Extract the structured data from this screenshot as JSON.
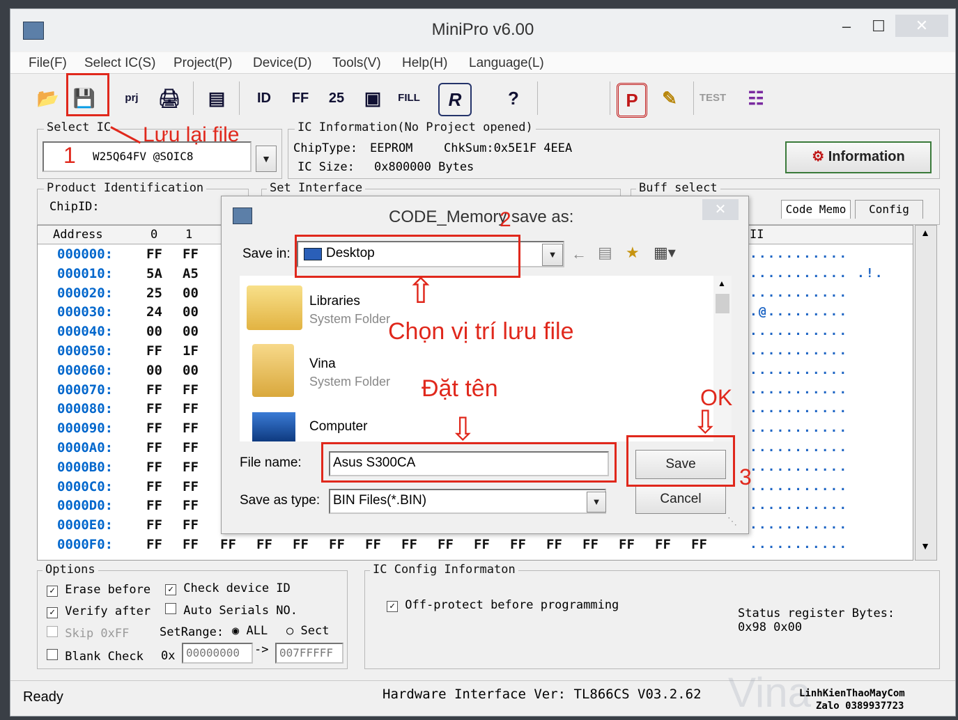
{
  "window": {
    "title": "MiniPro v6.00",
    "minimize": "–",
    "maximize": "☐",
    "close": "✕"
  },
  "menu": [
    "File(F)",
    "Select IC(S)",
    "Project(P)",
    "Device(D)",
    "Tools(V)",
    "Help(H)",
    "Language(L)"
  ],
  "toolbar": {
    "prj_label": "prj",
    "fill_label": "FILL",
    "test_label": "TEST",
    "p_label": "P",
    "r_label": "R",
    "help_label": "?"
  },
  "select_ic": {
    "label": "Select IC",
    "value": "W25Q64FV @SOIC8"
  },
  "ic_info": {
    "label": "IC Information(No Project opened)",
    "chip_type_label": "ChipType:",
    "chip_type": "EEPROM",
    "chksum": "ChkSum:0x5E1F 4EEA",
    "ic_size_label": "IC Size:",
    "ic_size": "0x800000 Bytes",
    "info_button": "Information"
  },
  "product_id": {
    "label": "Product Identification",
    "chip_id_label": "ChipID:"
  },
  "set_interface": {
    "label": "Set Interface"
  },
  "buff_select": {
    "label": "Buff select",
    "tab_code": "Code Memo",
    "tab_config": "Config"
  },
  "grid": {
    "headers": [
      "Address",
      "0",
      "1"
    ],
    "ascii_header": "II",
    "rows": [
      {
        "addr": "000000:",
        "b0": "FF",
        "b1": "FF"
      },
      {
        "addr": "000010:",
        "b0": "5A",
        "b1": "A5"
      },
      {
        "addr": "000020:",
        "b0": "25",
        "b1": "00"
      },
      {
        "addr": "000030:",
        "b0": "24",
        "b1": "00"
      },
      {
        "addr": "000040:",
        "b0": "00",
        "b1": "00"
      },
      {
        "addr": "000050:",
        "b0": "FF",
        "b1": "1F"
      },
      {
        "addr": "000060:",
        "b0": "00",
        "b1": "00"
      },
      {
        "addr": "000070:",
        "b0": "FF",
        "b1": "FF"
      },
      {
        "addr": "000080:",
        "b0": "FF",
        "b1": "FF"
      },
      {
        "addr": "000090:",
        "b0": "FF",
        "b1": "FF"
      },
      {
        "addr": "0000A0:",
        "b0": "FF",
        "b1": "FF"
      },
      {
        "addr": "0000B0:",
        "b0": "FF",
        "b1": "FF"
      },
      {
        "addr": "0000C0:",
        "b0": "FF",
        "b1": "FF"
      },
      {
        "addr": "0000D0:",
        "b0": "FF",
        "b1": "FF"
      },
      {
        "addr": "0000E0:",
        "b0": "FF",
        "b1": "FF"
      },
      {
        "addr": "0000F0:",
        "b0": "FF",
        "b1": "FF"
      }
    ],
    "last_row_rest": [
      "FF",
      "FF",
      "FF",
      "FF",
      "FF",
      "FF",
      "FF",
      "FF",
      "FF",
      "FF",
      "FF",
      "FF",
      "FF",
      "FF"
    ],
    "ascii_rows": [
      "...........",
      "...........  .!.",
      "...........",
      ".@.........",
      "...........",
      "...........",
      "...........",
      "...........",
      "...........",
      "...........",
      "...........",
      "...........",
      "...........",
      "...........",
      "...........",
      "..........."
    ]
  },
  "dialog": {
    "title": "CODE_Memory save as:",
    "save_in_label": "Save in:",
    "save_in_value": "Desktop",
    "items": [
      {
        "name": "Libraries",
        "sub": "System Folder"
      },
      {
        "name": "Vina",
        "sub": "System Folder"
      },
      {
        "name": "Computer",
        "sub": "System Folder"
      }
    ],
    "file_name_label": "File name:",
    "file_name_value": "Asus S300CA",
    "save_type_label": "Save as type:",
    "save_type_value": "BIN Files(*.BIN)",
    "save_button": "Save",
    "cancel_button": "Cancel",
    "close": "✕"
  },
  "annotations": {
    "save_file": "Lưu lại file",
    "step1": "1",
    "step2": "2",
    "step3": "3",
    "choose_location": "Chọn vị trí lưu file",
    "set_name": "Đặt tên",
    "ok": "OK"
  },
  "options": {
    "label": "Options",
    "erase_before": "Erase before",
    "check_device_id": "Check device ID",
    "verify_after": "Verify after",
    "auto_serials": "Auto Serials NO.",
    "skip_ff": "Skip 0xFF",
    "set_range": "SetRange:",
    "all": "ALL",
    "sect": "Sect",
    "blank_check": "Blank Check",
    "ox": "0x",
    "range_from": "00000000",
    "arrow": "->",
    "range_to": "007FFFFF"
  },
  "ic_config": {
    "label": "IC Config Informaton",
    "off_protect": "Off-protect before programming",
    "status_register": "Status register Bytes:",
    "status_value": "0x98 0x00"
  },
  "statusbar": {
    "ready": "Ready",
    "hardware": "Hardware Interface Ver: TL866CS V03.2.62",
    "watermark1": "LinhKienThaoMayCom",
    "watermark2": "Zalo 0389937723",
    "watermark_bg": "Vina"
  },
  "colors": {
    "annotation_red": "#e0281c",
    "address_blue": "#0066cc"
  }
}
